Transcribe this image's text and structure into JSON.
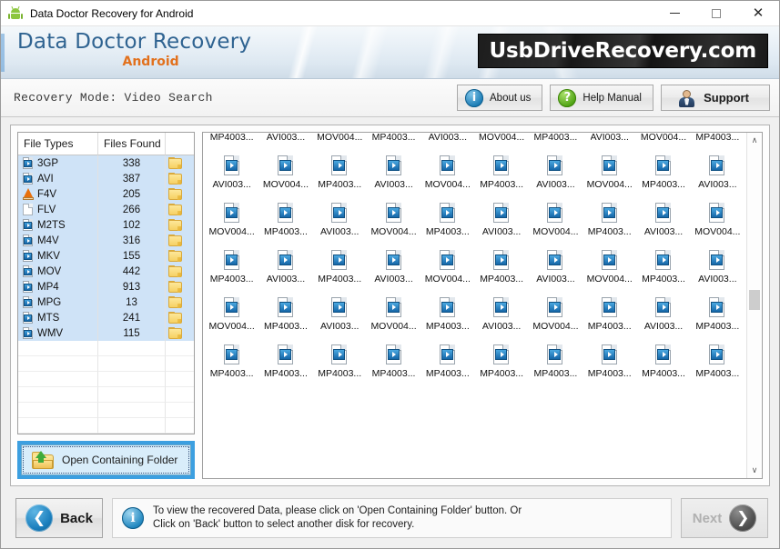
{
  "window": {
    "title": "Data Doctor Recovery for Android",
    "app_icon": "android-robot-icon",
    "controls": {
      "minimize": "—",
      "maximize": "□",
      "close": "✕"
    }
  },
  "banner": {
    "brand_main": "Data Doctor Recovery",
    "brand_sub": "Android",
    "website_logo": "UsbDriveRecovery.com",
    "brand_color": "#2f6391",
    "sub_color": "#e2711d"
  },
  "toolbar": {
    "mode_text": "Recovery Mode: Video Search",
    "buttons": [
      {
        "label": "About us",
        "icon": "info-icon"
      },
      {
        "label": "Help Manual",
        "icon": "question-icon"
      },
      {
        "label": "Support",
        "icon": "person-icon"
      }
    ]
  },
  "file_table": {
    "columns": [
      "File Types",
      "Files Found"
    ],
    "rows": [
      {
        "type": "3GP",
        "count": "338",
        "icon": "video-file-icon"
      },
      {
        "type": "AVI",
        "count": "387",
        "icon": "video-file-icon"
      },
      {
        "type": "F4V",
        "count": "205",
        "icon": "vlc-cone-icon"
      },
      {
        "type": "FLV",
        "count": "266",
        "icon": "blank-file-icon"
      },
      {
        "type": "M2TS",
        "count": "102",
        "icon": "video-file-icon"
      },
      {
        "type": "M4V",
        "count": "316",
        "icon": "video-file-icon"
      },
      {
        "type": "MKV",
        "count": "155",
        "icon": "video-file-icon"
      },
      {
        "type": "MOV",
        "count": "442",
        "icon": "video-file-icon"
      },
      {
        "type": "MP4",
        "count": "913",
        "icon": "video-file-icon"
      },
      {
        "type": "MPG",
        "count": "13",
        "icon": "video-file-icon"
      },
      {
        "type": "MTS",
        "count": "241",
        "icon": "video-file-icon"
      },
      {
        "type": "WMV",
        "count": "115",
        "icon": "video-file-icon"
      }
    ],
    "empty_rows": 6,
    "selection_color": "#cfe3f7"
  },
  "open_folder_button": {
    "label": "Open Containing Folder",
    "icon": "folder-up-arrow-icon",
    "focus_color": "#3c9fe0"
  },
  "file_grid": {
    "columns": 10,
    "items": [
      "MP4003...",
      "AVI003...",
      "MOV004...",
      "MP4003...",
      "AVI003...",
      "MOV004...",
      "MP4003...",
      "AVI003...",
      "MOV004...",
      "MP4003...",
      "AVI003...",
      "MOV004...",
      "MP4003...",
      "AVI003...",
      "MOV004...",
      "MP4003...",
      "AVI003...",
      "MOV004...",
      "MP4003...",
      "AVI003...",
      "MOV004...",
      "MP4003...",
      "AVI003...",
      "MOV004...",
      "MP4003...",
      "AVI003...",
      "MOV004...",
      "MP4003...",
      "AVI003...",
      "MOV004...",
      "MP4003...",
      "AVI003...",
      "MP4003...",
      "AVI003...",
      "MOV004...",
      "MP4003...",
      "AVI003...",
      "MOV004...",
      "MP4003...",
      "AVI003...",
      "MOV004...",
      "MP4003...",
      "AVI003...",
      "MOV004...",
      "MP4003...",
      "AVI003...",
      "MOV004...",
      "MP4003...",
      "AVI003...",
      "MP4003...",
      "MP4003...",
      "MP4003...",
      "MP4003...",
      "MP4003...",
      "MP4003...",
      "MP4003...",
      "MP4003...",
      "MP4003...",
      "MP4003...",
      "MP4003..."
    ],
    "scrollbar": {
      "up_glyph": "∧",
      "down_glyph": "∨",
      "thumb_position_pct": 45
    }
  },
  "footer": {
    "back_label": "Back",
    "back_icon": "arrow-left-icon",
    "next_label": "Next",
    "next_icon": "arrow-right-icon",
    "next_disabled": true,
    "status_icon": "info-icon",
    "status_line1": "To view the recovered Data, please click on 'Open Containing Folder' button. Or",
    "status_line2": "Click on 'Back' button to select another disk for recovery."
  }
}
